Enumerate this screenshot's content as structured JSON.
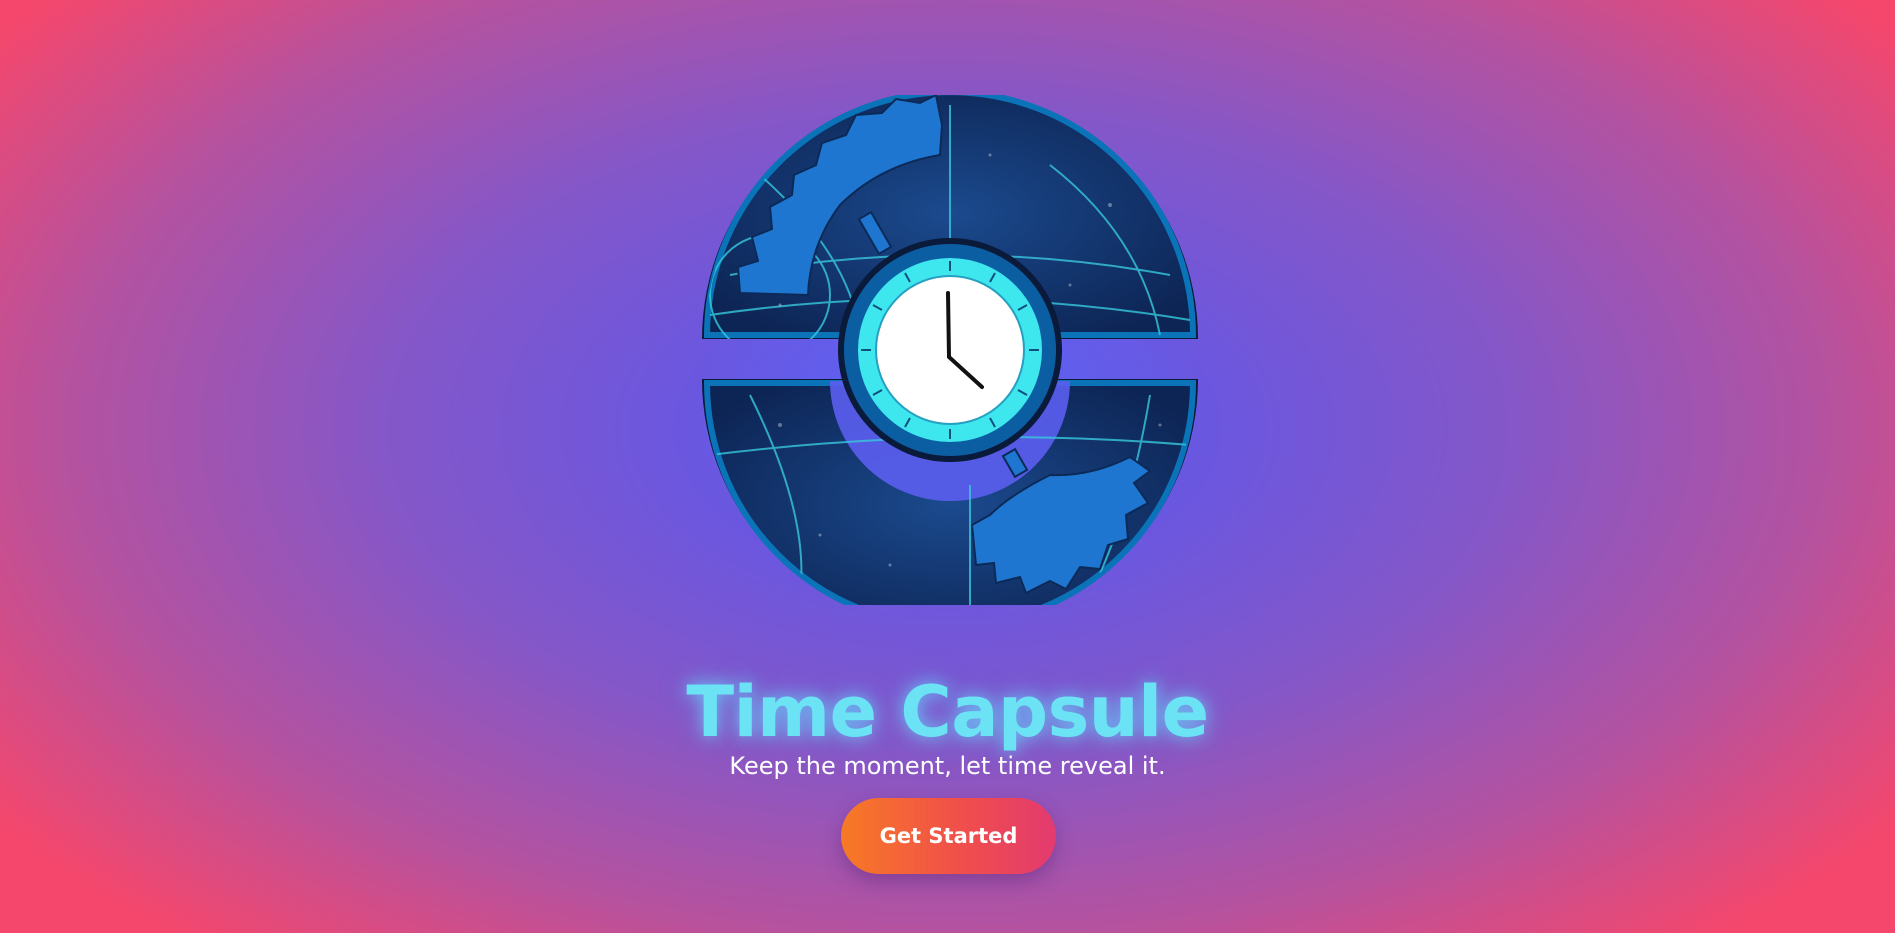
{
  "hero": {
    "title": "Time Capsule",
    "subtitle": "Keep the moment, let time reveal it.",
    "cta_label": "Get Started"
  },
  "logo": {
    "icon": "time-capsule-clock-logo"
  },
  "colors": {
    "background_center": "#5b5ef0",
    "background_edge": "#f5476c",
    "title": "#6ce3f5",
    "capsule_dark": "#0f2a5c",
    "gear": "#1f76d0",
    "clock_ring": "#3ee6ee",
    "button_start": "#f77a25",
    "button_end": "#e33a70"
  }
}
